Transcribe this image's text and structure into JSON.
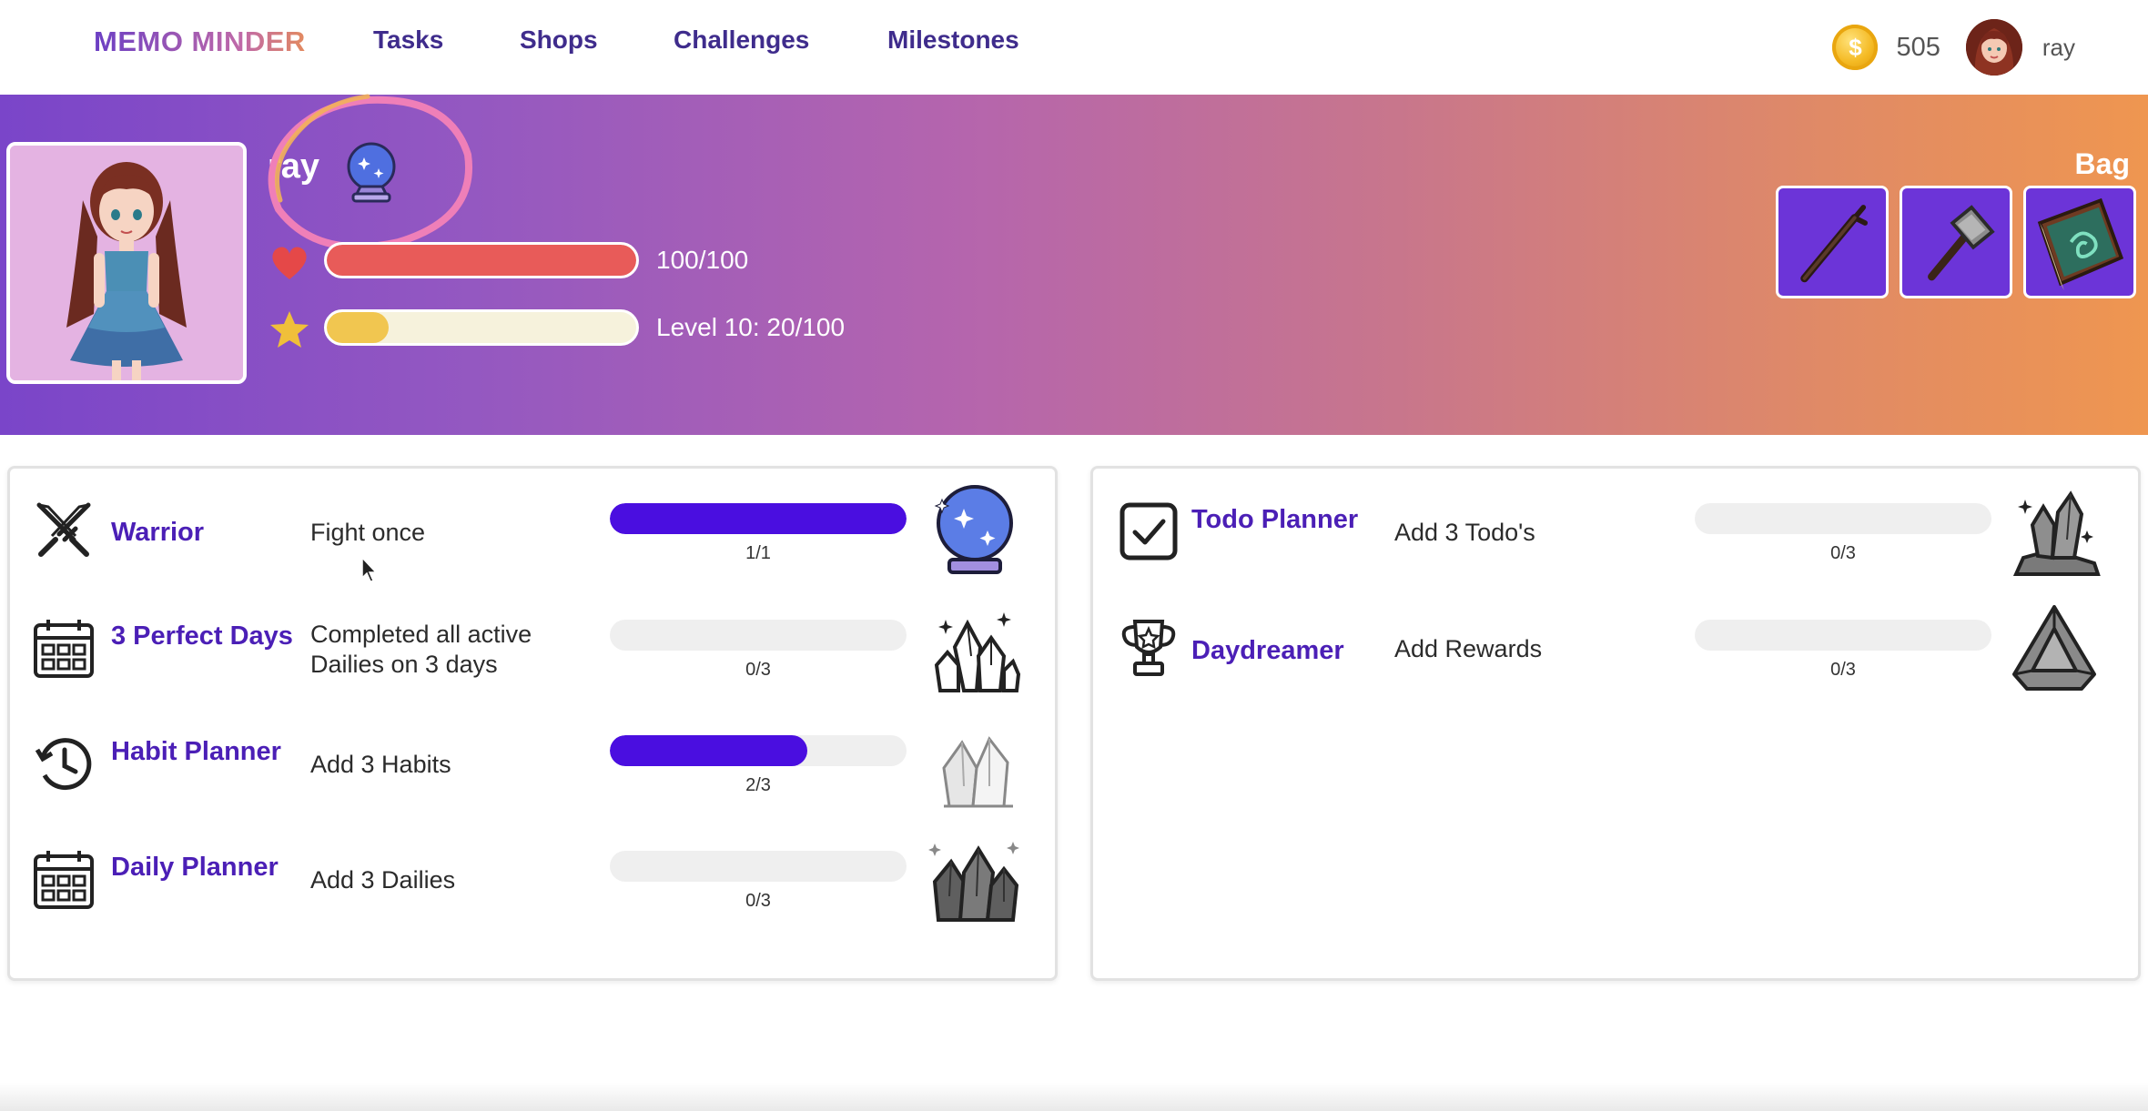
{
  "nav": {
    "logo": "MEMO MINDER",
    "links": [
      "Tasks",
      "Shops",
      "Challenges",
      "Milestones"
    ],
    "coin_symbol": "$",
    "coins": "505",
    "username": "ray"
  },
  "hero": {
    "name": "ray",
    "health_text": "100/100",
    "health_fraction": 1.0,
    "xp_text": "Level 10: 20/100",
    "xp_fraction": 0.2,
    "bag_label": "Bag",
    "bag_items": [
      "staff-icon",
      "hammer-icon",
      "spellbook-icon"
    ],
    "colors": {
      "gradient_start": "#7a45c9",
      "gradient_end": "#ef9650",
      "health": "#e85b59",
      "xp": "#f1c650",
      "xp_track": "#f6f2dc"
    }
  },
  "left_card": {
    "rows": [
      {
        "title": "Warrior",
        "description": "Fight once",
        "progress": "1/1",
        "fraction": 1.0,
        "icon": "crossed-swords-icon",
        "badge": "crystal-ball-badge"
      },
      {
        "title": "3 Perfect Days",
        "description": "Completed all active Dailies on 3 days",
        "progress": "0/3",
        "fraction": 0,
        "icon": "calendar-icon",
        "badge": "crystal-cluster-badge"
      },
      {
        "title": "Habit Planner",
        "description": "Add 3 Habits",
        "progress": "2/3",
        "fraction": 0.6667,
        "icon": "clock-icon",
        "badge": "crystal-badge"
      },
      {
        "title": "Daily Planner",
        "description": "Add 3 Dailies",
        "progress": "0/3",
        "fraction": 0,
        "icon": "calendar-icon",
        "badge": "dark-crystal-badge"
      }
    ]
  },
  "right_card": {
    "rows": [
      {
        "title": "Todo Planner",
        "description": "Add 3 Todo's",
        "progress": "0/3",
        "fraction": 0,
        "icon": "checkbox-icon",
        "badge": "crystal-rock-badge"
      },
      {
        "title": "Daydreamer",
        "description": "Add Rewards",
        "progress": "0/3",
        "fraction": 0,
        "icon": "trophy-icon",
        "badge": "pyramid-gem-badge"
      }
    ]
  },
  "accent_color": "#4a0ee0"
}
